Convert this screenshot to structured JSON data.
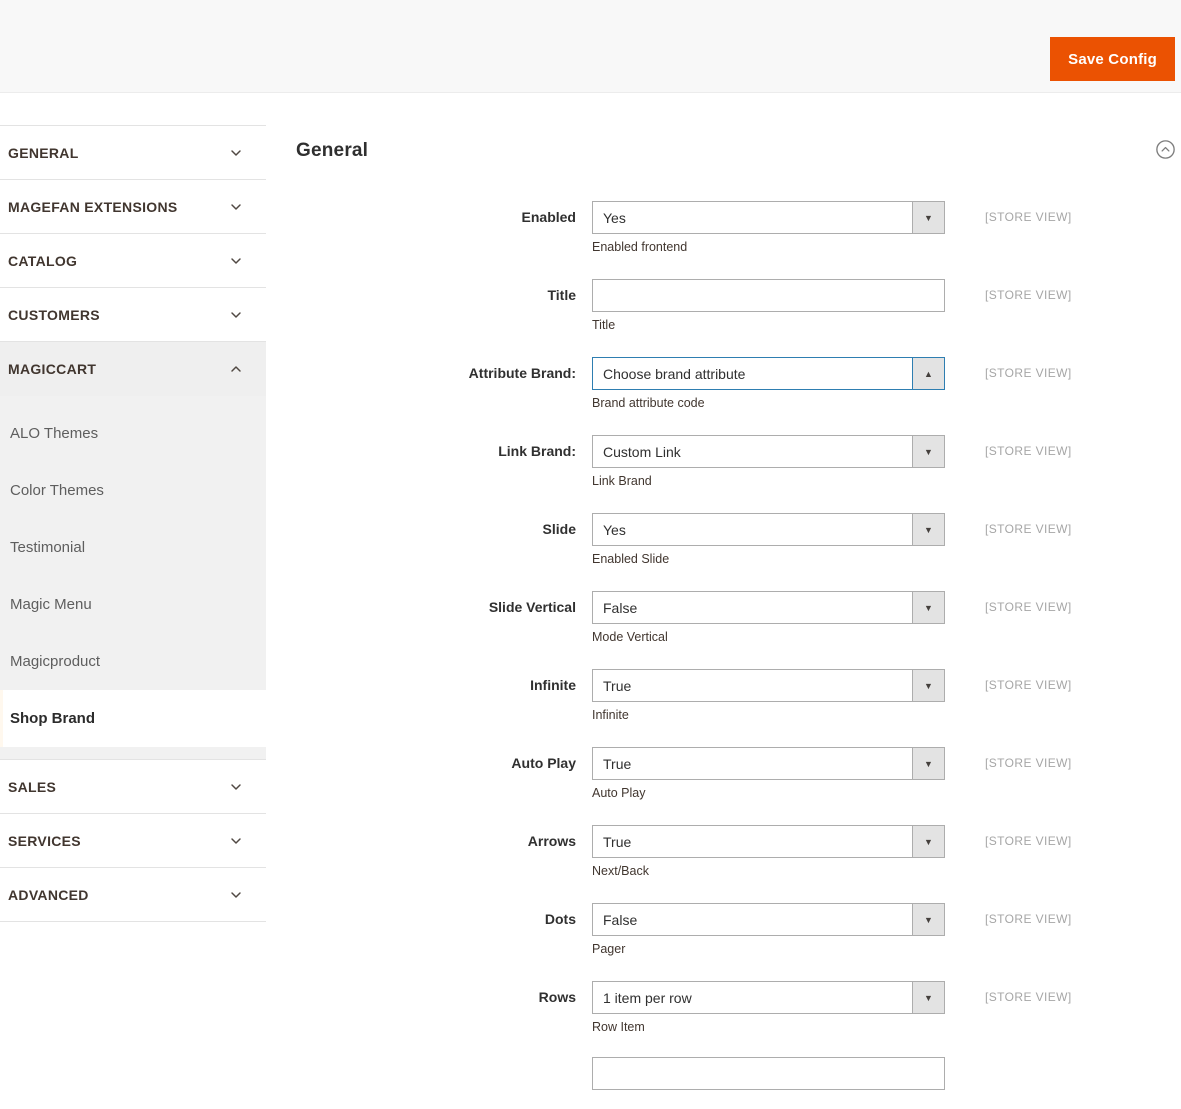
{
  "header": {
    "save_button": "Save Config"
  },
  "colors": {
    "accent": "#eb5202",
    "focus_border": "#2e7eb1",
    "sidebar_sub_bg": "#f1f1f1"
  },
  "icons": {
    "dropdown_down": "▼",
    "dropdown_up": "▲"
  },
  "sidebar": {
    "items": [
      {
        "kind": "section",
        "label": "GENERAL",
        "state": "collapsed"
      },
      {
        "kind": "section",
        "label": "MAGEFAN EXTENSIONS",
        "state": "collapsed"
      },
      {
        "kind": "section",
        "label": "CATALOG",
        "state": "collapsed"
      },
      {
        "kind": "section",
        "label": "CUSTOMERS",
        "state": "collapsed"
      },
      {
        "kind": "section",
        "label": "MAGICCART",
        "state": "expanded"
      },
      {
        "kind": "subitem",
        "label": "ALO Themes",
        "selected": false
      },
      {
        "kind": "subitem",
        "label": "Color Themes",
        "selected": false
      },
      {
        "kind": "subitem",
        "label": "Testimonial",
        "selected": false
      },
      {
        "kind": "subitem",
        "label": "Magic Menu",
        "selected": false
      },
      {
        "kind": "subitem",
        "label": "Magicproduct",
        "selected": false
      },
      {
        "kind": "subitem",
        "label": "Shop Brand",
        "selected": true
      },
      {
        "kind": "section",
        "label": "SALES",
        "state": "collapsed"
      },
      {
        "kind": "section",
        "label": "SERVICES",
        "state": "collapsed"
      },
      {
        "kind": "section",
        "label": "ADVANCED",
        "state": "collapsed"
      }
    ]
  },
  "main": {
    "section_title": "General",
    "scope_label": "[STORE VIEW]",
    "fields": [
      {
        "label": "Enabled",
        "type": "select",
        "value": "Yes",
        "note": "Enabled frontend",
        "focused": false
      },
      {
        "label": "Title",
        "type": "text",
        "value": "",
        "note": "Title",
        "focused": false
      },
      {
        "label": "Attribute Brand:",
        "type": "select",
        "value": "Choose brand attribute",
        "note": "Brand attribute code",
        "focused": true
      },
      {
        "label": "Link Brand:",
        "type": "select",
        "value": "Custom Link",
        "note": "Link Brand",
        "focused": false
      },
      {
        "label": "Slide",
        "type": "select",
        "value": "Yes",
        "note": "Enabled Slide",
        "focused": false
      },
      {
        "label": "Slide Vertical",
        "type": "select",
        "value": "False",
        "note": "Mode Vertical",
        "focused": false
      },
      {
        "label": "Infinite",
        "type": "select",
        "value": "True",
        "note": "Infinite",
        "focused": false
      },
      {
        "label": "Auto Play",
        "type": "select",
        "value": "True",
        "note": "Auto Play",
        "focused": false
      },
      {
        "label": "Arrows",
        "type": "select",
        "value": "True",
        "note": "Next/Back",
        "focused": false
      },
      {
        "label": "Dots",
        "type": "select",
        "value": "False",
        "note": "Pager",
        "focused": false
      },
      {
        "label": "Rows",
        "type": "select",
        "value": "1 item per row",
        "note": "Row Item",
        "focused": false
      }
    ],
    "partial_next_field_visible": true
  }
}
